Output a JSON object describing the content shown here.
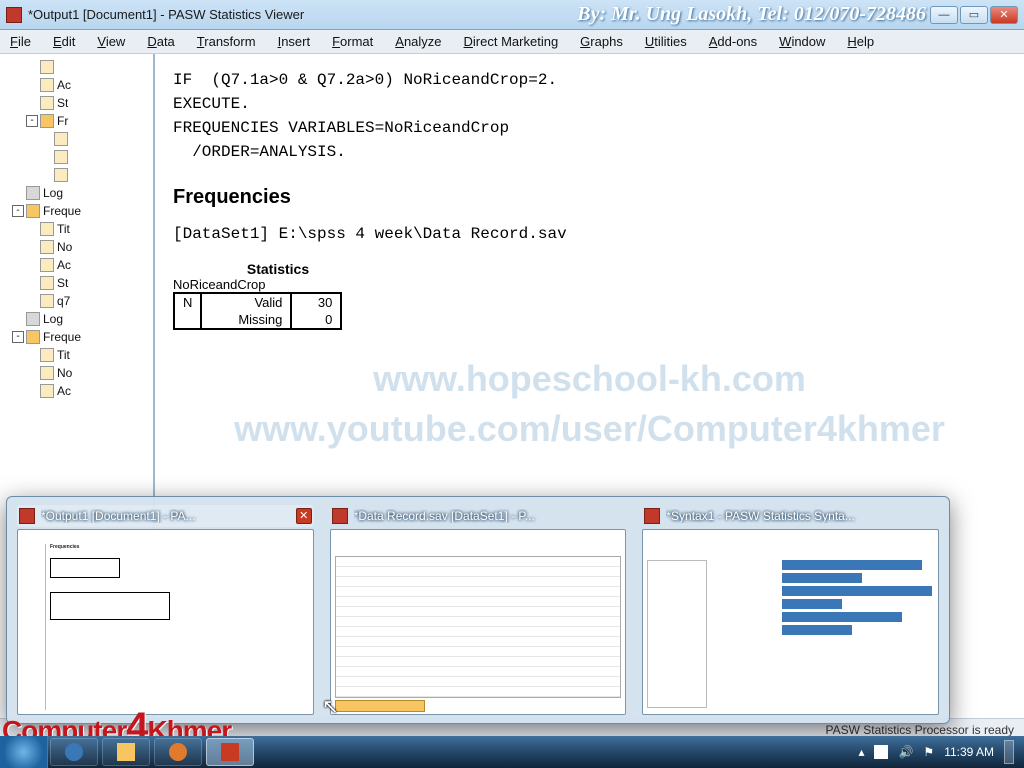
{
  "window": {
    "title": "*Output1 [Document1] - PASW Statistics Viewer",
    "byline": "By: Mr. Ung Lasokh, Tel: 012/070-728486"
  },
  "menu": [
    "File",
    "Edit",
    "View",
    "Data",
    "Transform",
    "Insert",
    "Format",
    "Analyze",
    "Direct Marketing",
    "Graphs",
    "Utilities",
    "Add-ons",
    "Window",
    "Help"
  ],
  "nav": [
    {
      "d": 2,
      "ic": "doc",
      "t": ""
    },
    {
      "d": 2,
      "ic": "doc",
      "t": "Ac"
    },
    {
      "d": 2,
      "ic": "doc",
      "t": "St"
    },
    {
      "d": 1,
      "tw": "-",
      "ic": "folder",
      "t": "Fr"
    },
    {
      "d": 3,
      "ic": "doc",
      "t": ""
    },
    {
      "d": 3,
      "ic": "doc",
      "t": ""
    },
    {
      "d": 3,
      "ic": "doc",
      "t": ""
    },
    {
      "d": 1,
      "ic": "log",
      "t": "Log"
    },
    {
      "d": 0,
      "tw": "-",
      "ic": "folder",
      "t": "Freque"
    },
    {
      "d": 2,
      "ic": "doc",
      "t": "Tit"
    },
    {
      "d": 2,
      "ic": "doc",
      "t": "No"
    },
    {
      "d": 2,
      "ic": "doc",
      "t": "Ac"
    },
    {
      "d": 2,
      "ic": "doc",
      "t": "St"
    },
    {
      "d": 2,
      "ic": "doc",
      "t": "q7"
    },
    {
      "d": 1,
      "ic": "log",
      "t": "Log"
    },
    {
      "d": 0,
      "tw": "-",
      "ic": "folder",
      "t": "Freque"
    },
    {
      "d": 2,
      "ic": "doc",
      "t": "Tit"
    },
    {
      "d": 2,
      "ic": "doc",
      "t": "No"
    },
    {
      "d": 2,
      "ic": "doc",
      "t": "Ac"
    }
  ],
  "syntax": "IF  (Q7.1a>0 & Q7.2a>0) NoRiceandCrop=2.\nEXECUTE.\nFREQUENCIES VARIABLES=NoRiceandCrop\n  /ORDER=ANALYSIS.",
  "freq_heading": "Frequencies",
  "dataset_line": "[DataSet1] E:\\spss 4 week\\Data Record.sav",
  "stats": {
    "title": "Statistics",
    "variable": "NoRiceandCrop",
    "rows": [
      {
        "a": "N",
        "b": "Valid",
        "c": "30"
      },
      {
        "a": "",
        "b": "Missing",
        "c": "0"
      }
    ]
  },
  "watermark": {
    "l1": "www.hopeschool-kh.com",
    "l2": "www.youtube.com/user/Computer4khmer"
  },
  "status": "PASW Statistics Processor is ready",
  "peek": [
    {
      "label": "*Output1 [Document1] - PA...",
      "active": true,
      "kind": "output"
    },
    {
      "label": "*Data Record.sav [DataSet1] - P...",
      "active": false,
      "kind": "data"
    },
    {
      "label": "*Syntax1 - PASW Statistics Synta...",
      "active": false,
      "kind": "syntax"
    }
  ],
  "tray": {
    "clock": "11:39 AM"
  },
  "brand": {
    "a": "Computer",
    "b": "4",
    "c": "Khmer"
  }
}
